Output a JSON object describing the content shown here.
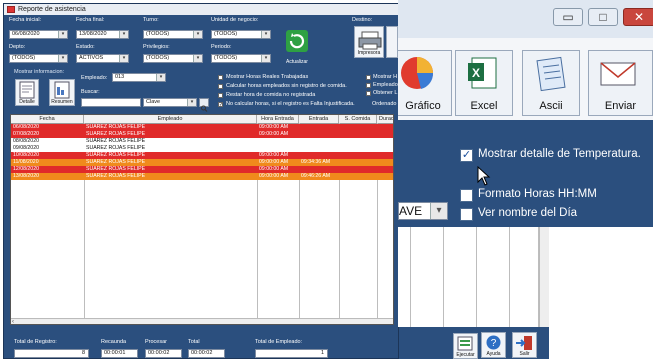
{
  "window": {
    "title": "Reporte de asistencia"
  },
  "filters": {
    "fecha_inicial_label": "Fecha inicial:",
    "fecha_inicial_value": "06/08/2020",
    "fecha_final_label": "Fecha final:",
    "fecha_final_value": "13/08/2020",
    "turno_label": "Turno:",
    "turno_value": "(TODOS)",
    "unidad_label": "Unidad de negocio:",
    "unidad_value": "(TODOS)",
    "depto_label": "Depto:",
    "depto_value": "(TODOS)",
    "estado_label": "Estado:",
    "estado_value": "ACTIVOS",
    "privilegios_label": "Privilegios:",
    "privilegios_value": "(TODOS)",
    "periodo_label": "Periodo:",
    "periodo_value": "(TODOS)",
    "actualizar_label": "Actualizar",
    "destino_label": "Destino:",
    "impresora_label": "Impresora"
  },
  "info": {
    "mostrar_label": "Mostrar informacion:",
    "detalle_label": "Detalle",
    "resumen_label": "Resumen",
    "empleado_label": "Empleado:",
    "empleado_value": "013",
    "buscar_label": "Buscar:",
    "buscar_value": "",
    "clave_value": "Clave"
  },
  "checks": [
    {
      "label": "Mostrar Horas Reales Trabajadas"
    },
    {
      "label": "Calcular horas empleados sin registro de comida."
    },
    {
      "label": "Restar hora de comida no registrada"
    },
    {
      "label": "No calcular horas, si el registro es Falta Injustificada.",
      "checked": true
    }
  ],
  "right_checks": [
    "Mostrar H",
    "Empleado",
    "Obtener L"
  ],
  "ordenado_label": "Ordenado",
  "grid": {
    "columns": [
      "Fecha",
      "Empleado",
      "Hora Entrada",
      "Entrada",
      "S. Comida",
      "Duracio"
    ],
    "rows": [
      {
        "fecha": "06/08/2020",
        "empleado": "SUAREZ ROJAS FELIPE",
        "hora_entrada": "09:00:00 AM",
        "entrada": "",
        "color": "#e02a2a",
        "text": "#ffffff"
      },
      {
        "fecha": "07/08/2020",
        "empleado": "SUAREZ ROJAS FELIPE",
        "hora_entrada": "09:00:00 AM",
        "entrada": "",
        "color": "#e02a2a",
        "text": "#ffffff"
      },
      {
        "fecha": "08/08/2020",
        "empleado": "SUAREZ ROJAS FELIPE",
        "hora_entrada": "",
        "entrada": "",
        "color": "#ffffff",
        "text": "#111111"
      },
      {
        "fecha": "09/08/2020",
        "empleado": "SUAREZ ROJAS FELIPE",
        "hora_entrada": "",
        "entrada": "",
        "color": "#ffffff",
        "text": "#111111"
      },
      {
        "fecha": "10/08/2020",
        "empleado": "SUAREZ ROJAS FELIPE",
        "hora_entrada": "09:00:00 AM",
        "entrada": "",
        "color": "#e02a2a",
        "text": "#ffffff"
      },
      {
        "fecha": "11/08/2020",
        "empleado": "SUAREZ ROJAS FELIPE",
        "hora_entrada": "09:00:00 AM",
        "entrada": "09:34:36 AM",
        "color": "#f08a1c",
        "text": "#ffffff"
      },
      {
        "fecha": "12/08/2020",
        "empleado": "SUAREZ ROJAS FELIPE",
        "hora_entrada": "09:00:00 AM",
        "entrada": "",
        "color": "#e02a2a",
        "text": "#ffffff"
      },
      {
        "fecha": "13/08/2020",
        "empleado": "SUAREZ ROJAS FELIPE",
        "hora_entrada": "09:00:00 AM",
        "entrada": "09:46:26 AM",
        "color": "#f08a1c",
        "text": "#ffffff"
      }
    ]
  },
  "footer": {
    "total_registro_label": "Total de Registro:",
    "total_registro_value": "8",
    "recaudar_label": "Recaunda",
    "recaudar_value": "00:00:01",
    "procesar_label": "Procesar",
    "procesar_value": "00:00:02",
    "total_label": "Total",
    "total_value": "00:00:02",
    "total_empleado_label": "Total de Empleado:",
    "total_empleado_value": "1",
    "ejecutar_label": "Ejecutar",
    "ayuda_label": "Ayuda",
    "salir_label": "Salir"
  },
  "zoom": {
    "grafico_label": "Gráfico",
    "excel_label": "Excel",
    "ascii_label": "Ascii",
    "enviar_label": "Enviar",
    "opt1": "Mostrar detalle de Temperatura.",
    "opt2": "Formato Horas HH:MM",
    "opt3": "Ver nombre del Día",
    "clave_partial": "AVE"
  },
  "colors": {
    "accent": "#2b4f7e",
    "late": "#e02a2a",
    "partial": "#f08a1c"
  }
}
